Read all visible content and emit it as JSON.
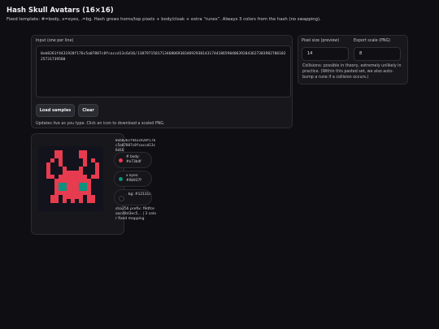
{
  "header": {
    "title": "Hash Skull Avatars (16×16)",
    "subtitle": "Fixed template: #=body, x=eyes, .=bg. Hash grows horns/top pixels + body/cloak + extra “runes”. Always 3 colors from the hash (no swapping)."
  },
  "input": {
    "label": "Input (one per line)",
    "value": "0xb8261f4431928f176c5a07887c8fcaccd13c6d16/13879715817134680693834692930143174418659040639204362738398270610225731739580",
    "load_label": "Load samples",
    "clear_label": "Clear",
    "hint": "Updates live as you type. Click an icon to download a scaled PNG."
  },
  "settings": {
    "pixel_label": "Pixel size (preview)",
    "pixel_value": "14",
    "export_label": "Export scale (PNG)",
    "export_value": "8",
    "note": "Collisions: possible in theory, extremely unlikely in practice. (Within this pasted set, we also auto-bump a rune if a collision occurs.)"
  },
  "avatar": {
    "hash_text": "0xb8261f4431928f176c5a07887c8fcaccd13c6d16",
    "chips": [
      {
        "text": "# body: #e73b4f",
        "color": "#e73b4f"
      },
      {
        "text": "x eyes: #0b937f",
        "color": "#0b937f"
      },
      {
        "text": ". bg: #12131c",
        "color": "#12131c"
      }
    ],
    "prefix": "sha256 prefix: f9dfceaac48d3ec5… | 3 color fixed mapping",
    "grid": [
      "................",
      "....##....##....",
      "....##....##....",
      "...#.#.....#.#..",
      "..#..#.....#..#.",
      "..#...#...#...#.",
      "..#...#####...#.",
      "..##.#######.##.",
      "....#########...",
      "....#xx###xx#...",
      "....#xx###xx#...",
      "....#########...",
      "...##.#####.##..",
      "...##.#.#.#.##..",
      "................",
      "................"
    ]
  }
}
